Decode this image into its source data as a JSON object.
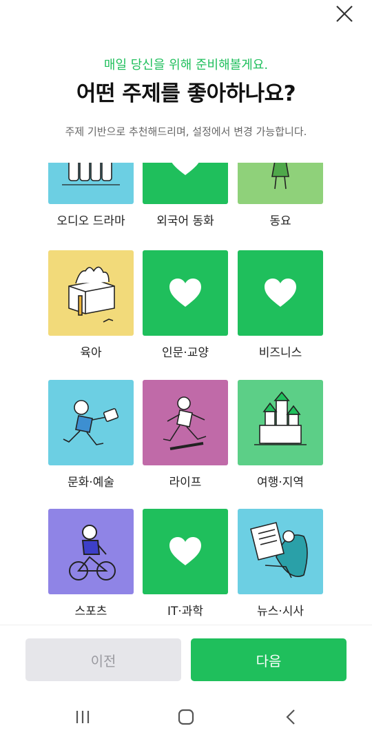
{
  "header": {
    "subtitle": "매일 당신을 위해 준비해볼게요.",
    "title": "어떤 주제를 좋아하나요?",
    "description": "주제 기반으로 추천해드리며, 설정에서 변경 가능합니다."
  },
  "topics": [
    {
      "label": "오디오 드라마",
      "color": "#6ccfe3",
      "illustration": "crowd-illustration",
      "selected": false
    },
    {
      "label": "외국어 동화",
      "color": "#1fbf5c",
      "illustration": "heart-icon",
      "selected": true
    },
    {
      "label": "동요",
      "color": "#8fd17a",
      "illustration": "singer-illustration",
      "selected": false
    },
    {
      "label": "육아",
      "color": "#f2da7a",
      "illustration": "box-illustration",
      "selected": false
    },
    {
      "label": "인문·교양",
      "color": "#1fbf5c",
      "illustration": "heart-icon",
      "selected": true
    },
    {
      "label": "비즈니스",
      "color": "#1fbf5c",
      "illustration": "heart-icon",
      "selected": true
    },
    {
      "label": "문화·예술",
      "color": "#6ccfe3",
      "illustration": "runner-bag-illustration",
      "selected": false
    },
    {
      "label": "라이프",
      "color": "#c06aa8",
      "illustration": "runner-illustration",
      "selected": false
    },
    {
      "label": "여행·지역",
      "color": "#5ccf87",
      "illustration": "castle-illustration",
      "selected": false
    },
    {
      "label": "스포츠",
      "color": "#8f84e6",
      "illustration": "cyclist-illustration",
      "selected": false
    },
    {
      "label": "IT·과학",
      "color": "#1fbf5c",
      "illustration": "heart-icon",
      "selected": true
    },
    {
      "label": "뉴스·시사",
      "color": "#6ccfe3",
      "illustration": "newspaper-reader-illustration",
      "selected": false
    }
  ],
  "buttons": {
    "prev_label": "이전",
    "next_label": "다음"
  },
  "nav": {
    "recents": "recents-icon",
    "home": "home-icon",
    "back": "back-icon"
  }
}
